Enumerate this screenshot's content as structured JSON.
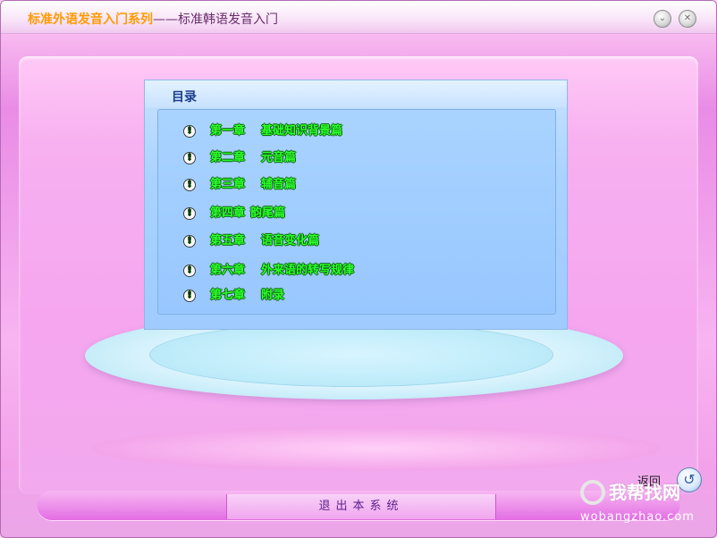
{
  "window": {
    "title_prefix": "标准外语发音入门系列",
    "title_suffix": "——标准韩语发音入门",
    "minimize_symbol": "⌄",
    "close_symbol": "✕"
  },
  "toc": {
    "title": "目录",
    "items": [
      {
        "chapter": "第一章",
        "name": "基础知识背景篇"
      },
      {
        "chapter": "第二章",
        "name": "元音篇"
      },
      {
        "chapter": "第三章",
        "name": "辅音篇"
      },
      {
        "chapter": "第四章",
        "name": "韵尾篇"
      },
      {
        "chapter": "第五章",
        "name": "语音变化篇"
      },
      {
        "chapter": "第六章",
        "name": "外来语的转写规律"
      },
      {
        "chapter": "第七章",
        "name": "附录"
      }
    ],
    "bullet_symbol": "!"
  },
  "footer": {
    "exit_label": "退出本系统",
    "back_label": "返回",
    "back_symbol": "↺"
  },
  "watermark": {
    "text": "我帮找网",
    "url": "wobangzhao.com"
  }
}
